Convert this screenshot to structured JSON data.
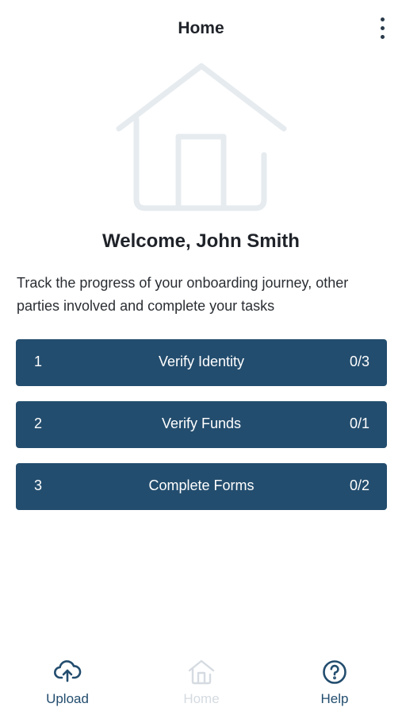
{
  "header": {
    "title": "Home",
    "menu_icon": "more-vertical-icon"
  },
  "hero": {
    "icon": "house-illustration-icon"
  },
  "welcome": {
    "heading": "Welcome, John Smith",
    "description": "Track the progress of your onboarding journey, other parties involved and complete your tasks"
  },
  "tasks": [
    {
      "number": "1",
      "label": "Verify Identity",
      "progress": "0/3"
    },
    {
      "number": "2",
      "label": "Verify Funds",
      "progress": "0/1"
    },
    {
      "number": "3",
      "label": "Complete Forms",
      "progress": "0/2"
    }
  ],
  "bottom_nav": {
    "items": [
      {
        "label": "Upload",
        "icon": "cloud-upload-icon",
        "state": "enabled"
      },
      {
        "label": "Home",
        "icon": "home-icon",
        "state": "disabled"
      },
      {
        "label": "Help",
        "icon": "help-circle-icon",
        "state": "enabled"
      }
    ]
  },
  "colors": {
    "primary": "#234d6e",
    "task_text": "#ffffff",
    "inactive": "#d5dbe1",
    "illustration": "#e6ebef"
  }
}
